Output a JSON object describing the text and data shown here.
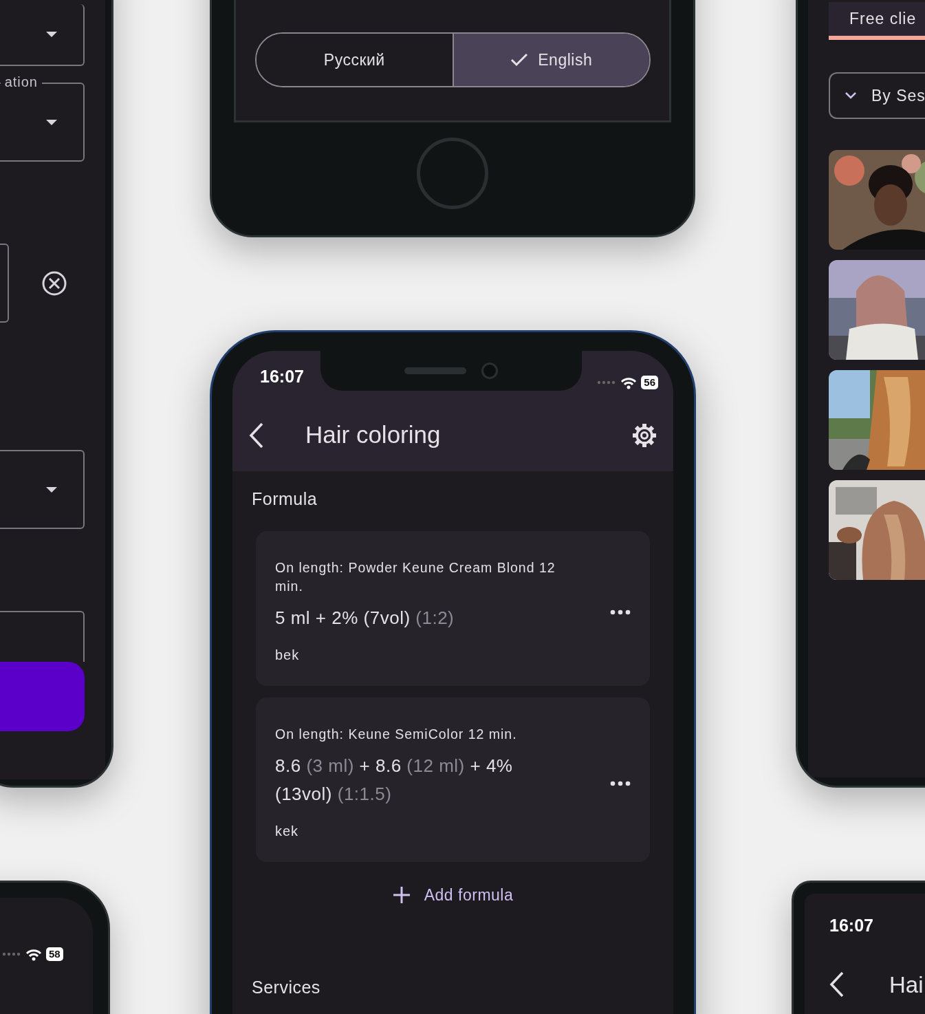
{
  "language_phone": {
    "options": [
      {
        "label": "Русский",
        "selected": false
      },
      {
        "label": "English",
        "selected": true
      }
    ]
  },
  "form_phone": {
    "fields": [
      {
        "kind": "dropdown"
      },
      {
        "kind": "dropdown",
        "label": "ation"
      },
      {
        "kind": "clearable"
      },
      {
        "kind": "dropdown"
      },
      {
        "kind": "text"
      }
    ]
  },
  "main_phone": {
    "status_bar": {
      "time": "16:07",
      "battery": "56"
    },
    "title": "Hair coloring",
    "formula_label": "Formula",
    "formulas": [
      {
        "description": "On length: Powder Keune Cream Blond 12 min.",
        "mix": [
          {
            "text": "5 ml + 2% (7vol)",
            "muted": false
          },
          {
            "text": "(1:2)",
            "muted": true
          }
        ],
        "note": "bek"
      },
      {
        "description": "On length: Keune SemiColor 12 min.",
        "mix": [
          {
            "text": "8.6",
            "muted": false
          },
          {
            "text": "(3 ml)",
            "muted": true
          },
          {
            "text": "+ 8.6",
            "muted": false
          },
          {
            "text": "(12 ml)",
            "muted": true
          },
          {
            "text": "+ 4% (13vol)",
            "muted": false
          },
          {
            "text": "(1:1.5)",
            "muted": true
          }
        ],
        "note": "kek"
      }
    ],
    "add_button": "Add formula",
    "services_label": "Services"
  },
  "gallery_phone": {
    "tab": {
      "label": "Free clie",
      "selected": true
    },
    "sort": {
      "label": "By Ses"
    }
  },
  "bottom_left_phone": {
    "battery": "58"
  },
  "bottom_right_phone": {
    "time": "16:07",
    "title": "Hai"
  }
}
